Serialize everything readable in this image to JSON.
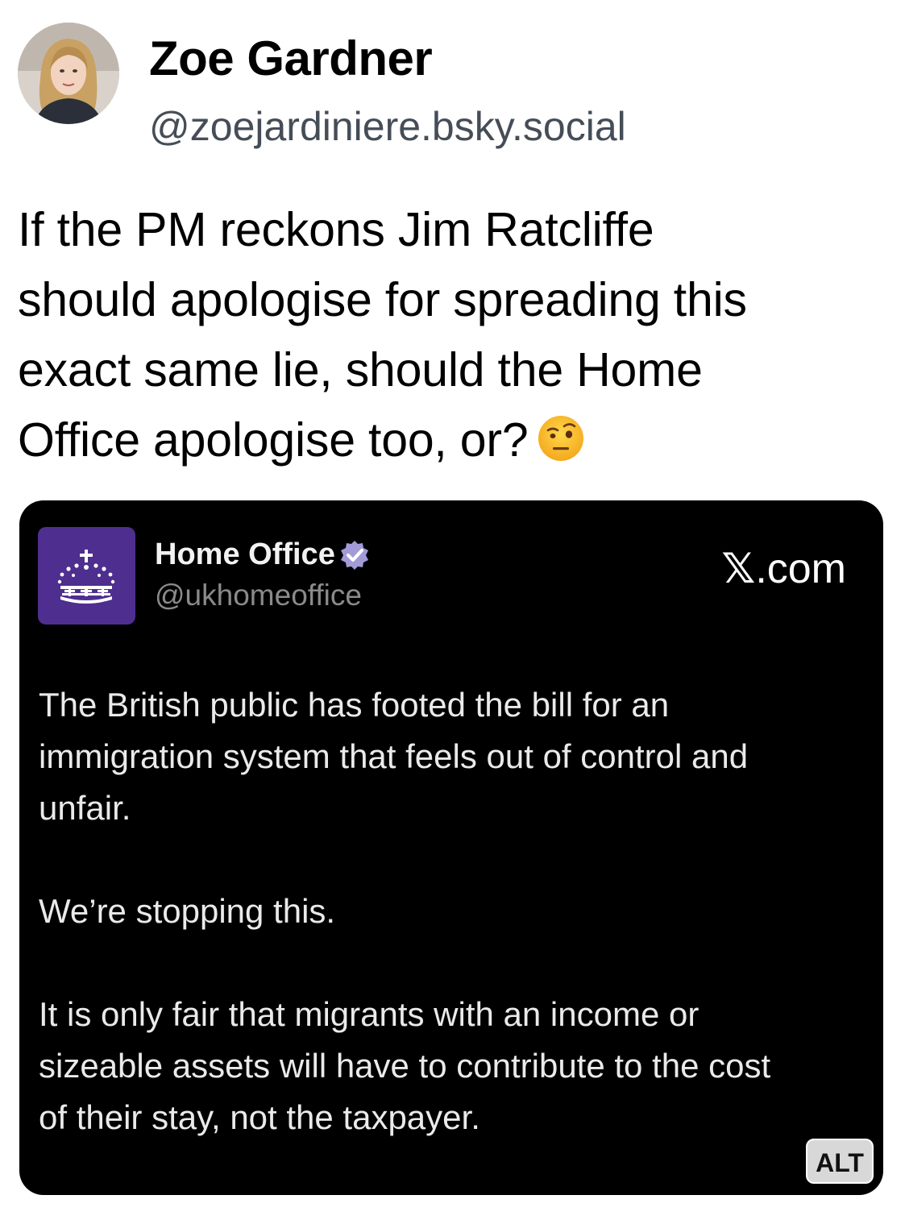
{
  "post": {
    "author": {
      "display_name": "Zoe Gardner",
      "handle": "@zoejardiniere.bsky.social"
    },
    "text_lines": [
      "If the PM reckons Jim Ratcliffe",
      "should apologise for spreading this",
      "exact same lie, should the Home",
      "Office apologise too, or?"
    ],
    "emoji": "face-with-raised-eyebrow-icon"
  },
  "embed": {
    "author": {
      "display_name": "Home Office",
      "handle": "@ukhomeoffice",
      "verified_icon": "verified-badge-icon",
      "logo_icon": "crown-crest-icon"
    },
    "source": {
      "mark": "𝕏",
      "suffix": ".com"
    },
    "paragraphs": [
      {
        "lines": [
          "The British public has footed the bill for an",
          "immigration system that feels out of control and",
          "unfair."
        ]
      },
      {
        "lines": [
          "We’re stopping this."
        ]
      },
      {
        "lines": [
          "It is only fair that migrants with an income or",
          "sizeable assets will have to contribute to the cost",
          "of their stay, not the taxpayer."
        ]
      }
    ],
    "alt_label": "ALT"
  },
  "colors": {
    "embed_background": "#000000",
    "logo_background": "#4e2e8f",
    "verified_badge": "#a29bd8",
    "handle_text": "#454d57"
  }
}
